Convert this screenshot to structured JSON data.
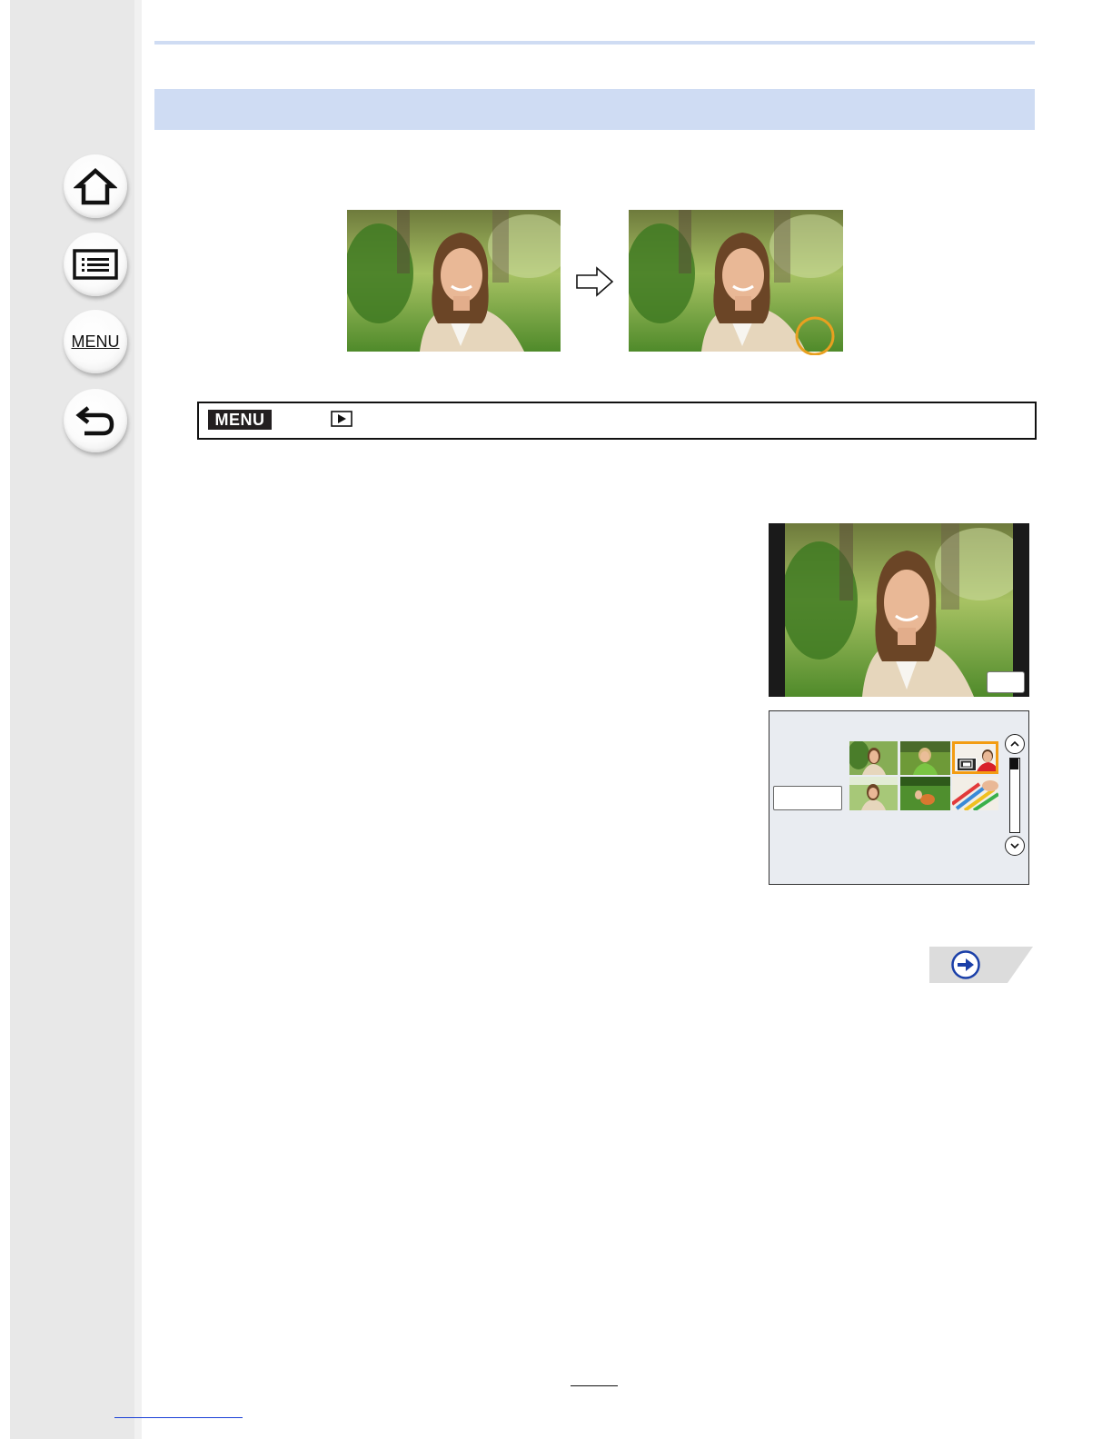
{
  "sidebar": {
    "buttons": [
      {
        "id": "home",
        "icon": "home-icon"
      },
      {
        "id": "contents",
        "icon": "list-icon"
      },
      {
        "id": "menu",
        "icon": "menu-text-icon",
        "label": "MENU"
      },
      {
        "id": "back",
        "icon": "back-arrow-icon"
      }
    ]
  },
  "menu_path": {
    "badge": "MENU",
    "icon": "playback-icon"
  },
  "comparison": {
    "arrow_icon": "arrow-right-icon",
    "highlight_color": "#e8a020"
  },
  "grid_screen": {
    "scroll_up_icon": "chevron-up-icon",
    "scroll_down_icon": "chevron-down-icon",
    "selected_badge_icon": "image-stack-icon",
    "selected_color": "#f39c12"
  },
  "next_page": {
    "icon": "next-arrow-icon",
    "color": "#1a3fa8"
  },
  "colors": {
    "band": "#cfdcf3",
    "sidebar": "#e8e8e8"
  }
}
